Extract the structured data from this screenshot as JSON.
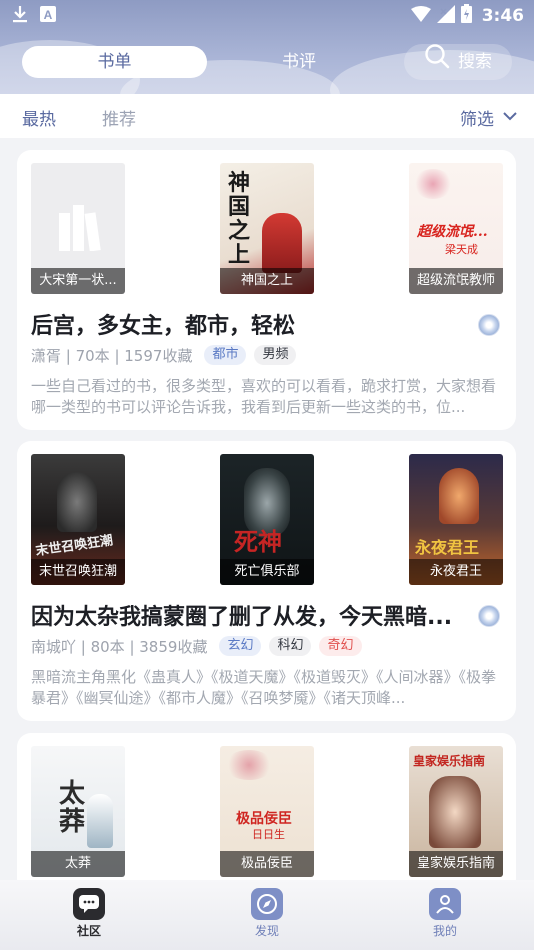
{
  "status_bar": {
    "time": "3:46",
    "left_icons": [
      "download-icon",
      "notification-a-icon"
    ],
    "right_icons": [
      "wifi-icon",
      "signal-icon",
      "battery-icon"
    ]
  },
  "header": {
    "tabs": [
      {
        "label": "书单",
        "active": true
      },
      {
        "label": "书评",
        "active": false
      }
    ],
    "search_label": "搜索"
  },
  "filter_bar": {
    "hot": "最热",
    "recommend": "推荐",
    "filter": "筛选"
  },
  "cards": [
    {
      "covers": [
        {
          "caption": "大宋第一状..."
        },
        {
          "caption": "神国之上"
        },
        {
          "caption": "超级流氓教师"
        }
      ],
      "title": "后宫，多女主，都市，轻松",
      "meta": "潇胥 | 70本 | 1597收藏",
      "tags": [
        {
          "label": "都市",
          "style": "blue"
        },
        {
          "label": "男频",
          "style": "gray"
        }
      ],
      "description": "一些自己看过的书，很多类型，喜欢的可以看看，跪求打赏，大家想看哪一类型的书可以评论告诉我，我看到后更新一些这类的书，位..."
    },
    {
      "covers": [
        {
          "caption": "末世召唤狂潮"
        },
        {
          "caption": "死亡俱乐部"
        },
        {
          "caption": "永夜君王"
        }
      ],
      "title": "因为太杂我搞蒙圈了删了从发，今天黑暗...",
      "meta": "南城吖 | 80本 | 3859收藏",
      "tags": [
        {
          "label": "玄幻",
          "style": "blue"
        },
        {
          "label": "科幻",
          "style": "gray"
        },
        {
          "label": "奇幻",
          "style": "red"
        }
      ],
      "description": "黑暗流主角黑化《蛊真人》《极道天魔》《极道毁灭》《人间冰器》《极拳暴君》《幽冥仙途》《都市人魔》《召唤梦魇》《诸天顶峰..."
    },
    {
      "covers": [
        {
          "caption": "太莽"
        },
        {
          "caption": "极品佞臣"
        },
        {
          "caption": "皇家娱乐指南"
        }
      ]
    }
  ],
  "cover_art": {
    "c1_2": "神国之上",
    "c1_3_title": "超级流氓...",
    "c1_3_author": "梁天成",
    "c2_1": "末世召唤狂潮",
    "c2_2": "死神",
    "c2_3": "永夜君王",
    "c3_1": "太莽",
    "c3_2_title": "极品佞臣",
    "c3_2_author": "日日生",
    "c3_3": "皇家娱乐指南"
  },
  "bottom_nav": [
    {
      "label": "社区",
      "icon": "chat-bubble-icon",
      "active": true
    },
    {
      "label": "发现",
      "icon": "compass-icon",
      "active": false
    },
    {
      "label": "我的",
      "icon": "person-icon",
      "active": false
    }
  ],
  "colors": {
    "accent": "#5a6aa0",
    "header_gradient_top": "#8e9bc3",
    "tag_blue": "#5a79c4",
    "tag_red": "#e0504e",
    "muted_text": "#9ea3ad"
  }
}
